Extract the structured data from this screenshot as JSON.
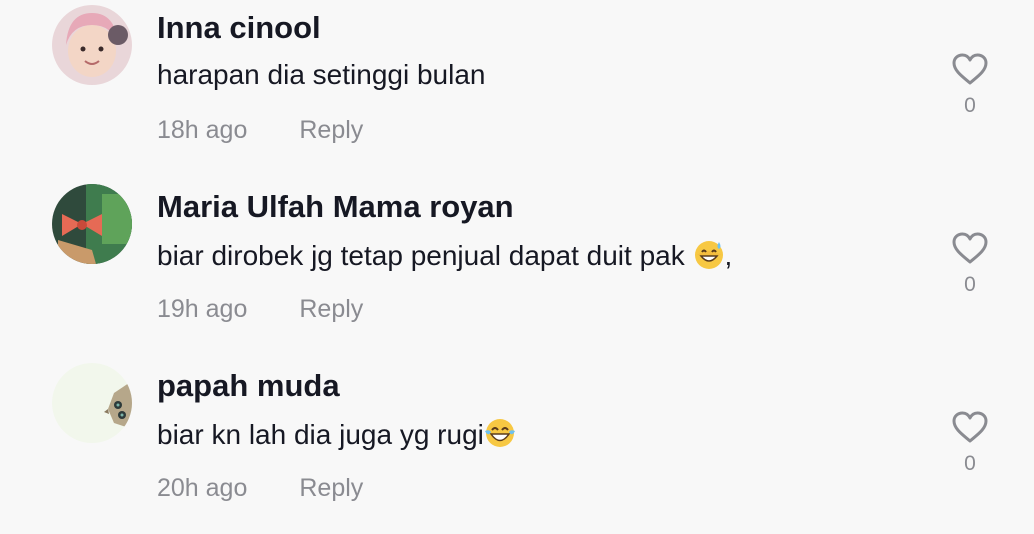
{
  "comments": [
    {
      "username": "Inna cinool",
      "text": "harapan dia setinggi bulan",
      "time": "18h ago",
      "reply_label": "Reply",
      "likes": "0"
    },
    {
      "username": "Maria Ulfah Mama royan",
      "text": "biar dirobek jg tetap penjual dapat duit pak ",
      "emoji": "grinning-sweat",
      "text_after": ",",
      "time": "19h ago",
      "reply_label": "Reply",
      "likes": "0"
    },
    {
      "username": "papah muda",
      "text": "biar kn lah dia juga yg rugi",
      "emoji": "tears-of-joy",
      "time": "20h ago",
      "reply_label": "Reply",
      "likes": "0"
    }
  ],
  "colors": {
    "background": "#f8f8f8",
    "username": "#161823",
    "meta": "#8a8b91"
  }
}
